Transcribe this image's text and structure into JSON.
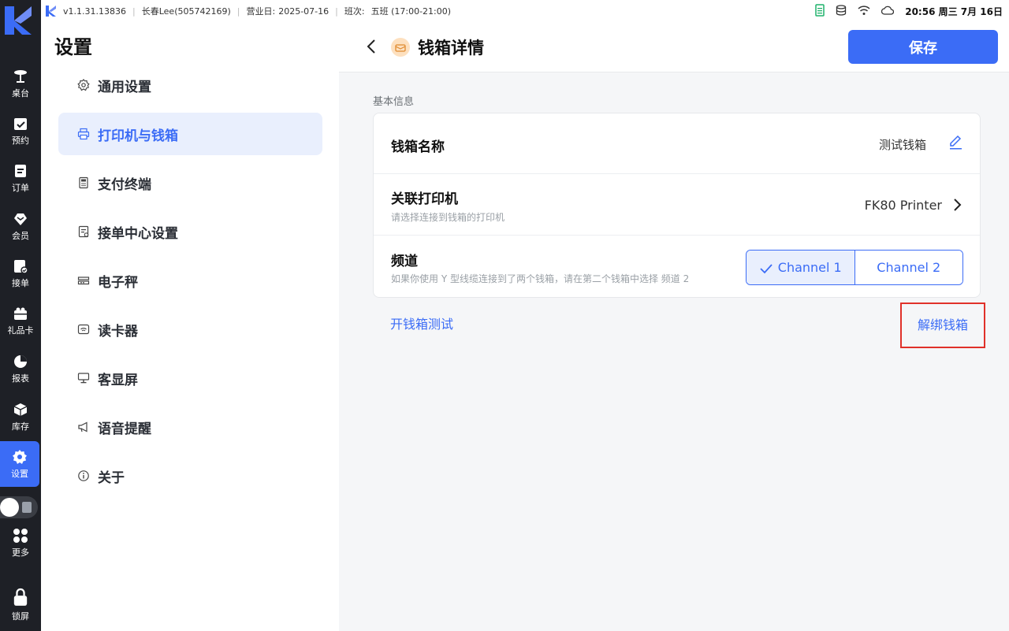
{
  "status_bar": {
    "version": "v1.1.31.13836",
    "user": "长春Lee(505742169)",
    "business_day_label": "营业日:",
    "business_day": "2025-07-16",
    "shift_label": "班次:",
    "shift": "五班 (17:00-21:00)",
    "clock": "20:56 周三 7月 16日"
  },
  "rail": {
    "items": [
      {
        "label": "桌台",
        "icon": "table-icon"
      },
      {
        "label": "预约",
        "icon": "reservation-icon"
      },
      {
        "label": "订单",
        "icon": "order-icon"
      },
      {
        "label": "会员",
        "icon": "member-icon"
      },
      {
        "label": "接单",
        "icon": "accept-order-icon"
      },
      {
        "label": "礼品卡",
        "icon": "gift-card-icon"
      },
      {
        "label": "报表",
        "icon": "report-icon"
      },
      {
        "label": "库存",
        "icon": "inventory-icon"
      },
      {
        "label": "设置",
        "icon": "gear-icon"
      }
    ],
    "more_label": "更多",
    "lock_label": "锁屏"
  },
  "settings": {
    "title": "设置",
    "menu": [
      {
        "label": "通用设置",
        "icon": "gear-icon"
      },
      {
        "label": "打印机与钱箱",
        "icon": "printer-icon"
      },
      {
        "label": "支付终端",
        "icon": "payment-terminal-icon"
      },
      {
        "label": "接单中心设置",
        "icon": "order-center-icon"
      },
      {
        "label": "电子秤",
        "icon": "scale-icon"
      },
      {
        "label": "读卡器",
        "icon": "card-reader-icon"
      },
      {
        "label": "客显屏",
        "icon": "customer-display-icon"
      },
      {
        "label": "语音提醒",
        "icon": "megaphone-icon"
      },
      {
        "label": "关于",
        "icon": "info-icon"
      }
    ]
  },
  "detail": {
    "title": "钱箱详情",
    "save_label": "保存",
    "section_label": "基本信息",
    "name_label": "钱箱名称",
    "name_value": "测试钱箱",
    "printer_label": "关联打印机",
    "printer_sub": "请选择连接到钱箱的打印机",
    "printer_value": "FK80 Printer",
    "channel_label": "频道",
    "channel_sub": "如果你使用 Y 型线缆连接到了两个钱箱，请在第二个钱箱中选择 频道 2",
    "channel_options": [
      "Channel 1",
      "Channel 2"
    ],
    "open_test_label": "开钱箱测试",
    "unbind_label": "解绑钱箱"
  },
  "colors": {
    "accent": "#3b6cf6",
    "rail_bg": "#1e2026",
    "highlight_border": "#e0312a"
  }
}
